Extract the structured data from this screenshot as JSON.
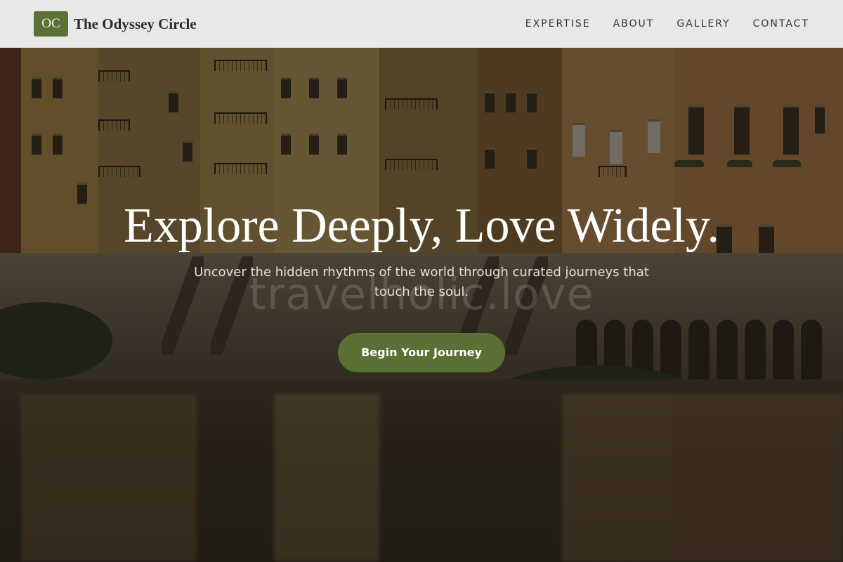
{
  "nav": {
    "logo_initials": "OC",
    "brand_name": "The Odyssey Circle",
    "links": [
      {
        "label": "EXPERTISE"
      },
      {
        "label": "ABOUT"
      },
      {
        "label": "GALLERY"
      },
      {
        "label": "CONTACT"
      }
    ]
  },
  "hero": {
    "headline": "Explore Deeply, Love Widely.",
    "subtitle": "Uncover the hidden rhythms of the world through curated journeys that touch the soul.",
    "cta_label": "Begin Your Journey",
    "watermark": "travelholic.love",
    "background": "riverside-buildings-photo"
  },
  "colors": {
    "accent": "#5a7034",
    "nav_background": "#eeeeee",
    "headline_text": "#ffffff"
  }
}
